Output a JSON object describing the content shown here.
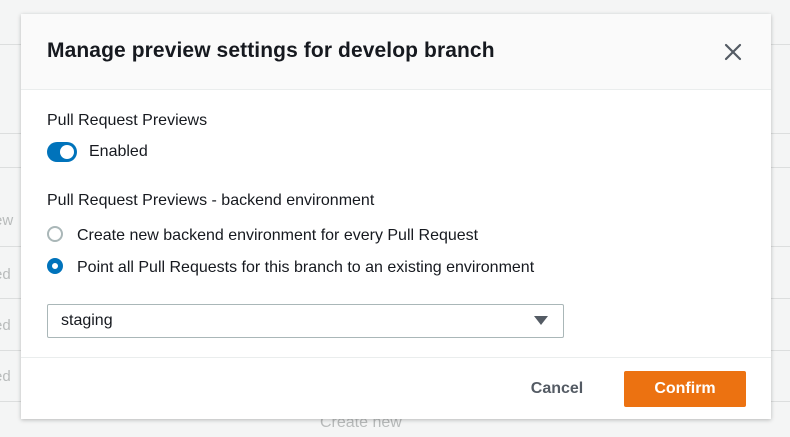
{
  "background": {
    "row_texts": [
      "ew",
      "ed",
      "ed",
      "ed"
    ],
    "create_new_label": "Create new"
  },
  "modal": {
    "title": "Manage preview settings for develop branch",
    "close_icon": "close-icon",
    "pr_previews": {
      "label": "Pull Request Previews",
      "toggle_state": true,
      "toggle_label": "Enabled"
    },
    "backend": {
      "label": "Pull Request Previews - backend environment",
      "options": [
        {
          "label": "Create new backend environment for every Pull Request",
          "selected": false
        },
        {
          "label": "Point all Pull Requests for this branch to an existing environment",
          "selected": true
        }
      ],
      "environment_select": {
        "value": "staging",
        "caret_icon": "caret-down-icon"
      }
    },
    "footer": {
      "cancel_label": "Cancel",
      "confirm_label": "Confirm"
    }
  },
  "colors": {
    "accent": "#0073bb",
    "primary_button": "#ec7211",
    "text": "#16191f",
    "muted": "#545b64"
  }
}
